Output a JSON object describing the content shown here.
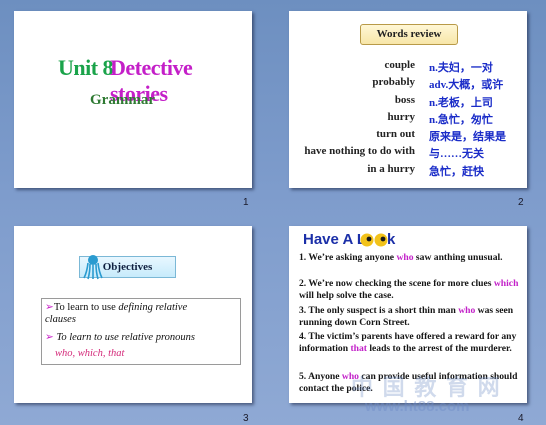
{
  "slides": [
    {
      "number": "1",
      "unit": "Unit 8",
      "title": "Detective stories",
      "subtitle": "Grammar"
    },
    {
      "number": "2",
      "heading": "Words review",
      "words": [
        {
          "en": "couple",
          "zh": "n.夫妇，一对"
        },
        {
          "en": "probably",
          "zh": "adv.大概，或许"
        },
        {
          "en": "boss",
          "zh": "n.老板，上司"
        },
        {
          "en": "hurry",
          "zh": "n.急忙，匆忙"
        },
        {
          "en": "turn out",
          "zh": "原来是，结果是"
        },
        {
          "en": "have nothing to do with",
          "zh": "与……无关"
        },
        {
          "en": "in a hurry",
          "zh": "急忙，赶快"
        }
      ]
    },
    {
      "number": "3",
      "heading": "Objectives",
      "goal1_prefix": "To learn to use ",
      "goal1_em": "defining relative",
      "goal1_line2": "clauses",
      "goal2": "To learn to use relative pronouns",
      "goal2_pronouns": "who, which, that"
    },
    {
      "number": "4",
      "title_part1": "Have A L",
      "title_part2": "k",
      "sentences": [
        {
          "pre": "1. We’re asking anyone ",
          "hl": "who",
          "post": " saw anthing unusual."
        },
        {
          "pre": "2. We’re now checking the scene for more clues ",
          "hl": "which",
          "post": " will help solve the case."
        },
        {
          "pre": "3. The only suspect is a short thin man ",
          "hl": "who",
          "post": " was seen running down Corn Street."
        },
        {
          "pre": "4. The victim’s parents have offered a reward for any information ",
          "hl": "that",
          "post": " leads to the arrest of the murderer."
        },
        {
          "pre": "5. Anyone ",
          "hl": "who",
          "post": " can provide useful information should contact the police."
        }
      ],
      "watermark_cn": "中 国 教 育 网",
      "watermark_url": "www.ht88.com"
    }
  ]
}
